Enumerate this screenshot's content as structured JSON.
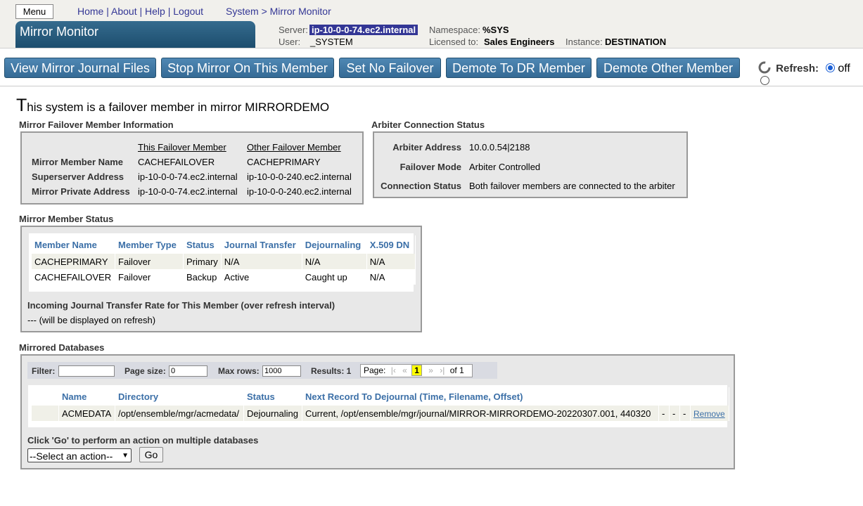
{
  "header": {
    "menu_label": "Menu",
    "links": [
      "Home",
      "About",
      "Help",
      "Logout"
    ],
    "breadcrumb": "System > Mirror Monitor",
    "title": "Mirror Monitor",
    "server_label": "Server:",
    "server": "ip-10-0-0-74.ec2.internal",
    "user_label": "User:",
    "user": "_SYSTEM",
    "namespace_label": "Namespace:",
    "namespace": "%SYS",
    "licensed_label": "Licensed to:",
    "licensed": "Sales Engineers",
    "instance_label": "Instance:",
    "instance": "DESTINATION"
  },
  "toolbar": {
    "buttons": [
      "View Mirror Journal Files",
      "Stop Mirror On This Member",
      "Set No Failover",
      "Demote To DR Member",
      "Demote Other Member"
    ],
    "refresh_label": "Refresh:",
    "refresh_option": "off"
  },
  "page_heading_first": "T",
  "page_heading_rest": "his system is a failover member in mirror MIRRORDEMO",
  "failover_info": {
    "title": "Mirror Failover Member Information",
    "col_this": "This Failover Member",
    "col_other": "Other Failover Member",
    "rows": [
      {
        "label": "Mirror Member Name",
        "this": "CACHEFAILOVER",
        "other": "CACHEPRIMARY"
      },
      {
        "label": "Superserver Address",
        "this": "ip-10-0-0-74.ec2.internal",
        "other": "ip-10-0-0-240.ec2.internal"
      },
      {
        "label": "Mirror Private Address",
        "this": "ip-10-0-0-74.ec2.internal",
        "other": "ip-10-0-0-240.ec2.internal"
      }
    ]
  },
  "arbiter": {
    "title": "Arbiter Connection Status",
    "rows": [
      {
        "label": "Arbiter Address",
        "value": "10.0.0.54|2188"
      },
      {
        "label": "Failover Mode",
        "value": "Arbiter Controlled"
      },
      {
        "label": "Connection Status",
        "value": "Both failover members are connected to the arbiter"
      }
    ]
  },
  "member_status": {
    "title": "Mirror Member Status",
    "columns": [
      "Member Name",
      "Member Type",
      "Status",
      "Journal Transfer",
      "Dejournaling",
      "X.509 DN"
    ],
    "rows": [
      [
        "CACHEPRIMARY",
        "Failover",
        "Primary",
        "N/A",
        "N/A",
        "N/A"
      ],
      [
        "CACHEFAILOVER",
        "Failover",
        "Backup",
        "Active",
        "Caught up",
        "N/A"
      ]
    ],
    "rate_title": "Incoming Journal Transfer Rate for This Member (over refresh interval)",
    "rate_value": "--- (will be displayed on refresh)"
  },
  "databases": {
    "title": "Mirrored Databases",
    "filter_label": "Filter:",
    "filter_value": "",
    "page_size_label": "Page size:",
    "page_size": "0",
    "max_rows_label": "Max rows:",
    "max_rows": "1000",
    "results_label": "Results: 1",
    "page_label": "Page:",
    "page_first": "|‹",
    "page_prev": "«",
    "page_current": "1",
    "page_next": "»",
    "page_last": "›|",
    "page_of": "of 1",
    "columns": [
      "Name",
      "Directory",
      "Status",
      "Next Record To Dejournal (Time, Filename, Offset)"
    ],
    "rows": [
      {
        "name": "ACMEDATA",
        "directory": "/opt/ensemble/mgr/acmedata/",
        "status": "Dejournaling",
        "next": "Current, /opt/ensemble/mgr/journal/MIRROR-MIRRORDEMO-20220307.001, 440320",
        "d1": "-",
        "d2": "-",
        "d3": "-",
        "action": "Remove"
      }
    ],
    "go_hint": "Click 'Go' to perform an action on multiple databases",
    "select_value": "--Select an action--",
    "go_label": "Go"
  },
  "colors": {
    "accent": "#333695",
    "button": "#4a82ae",
    "header_text": "#3b6fa7",
    "highlight": "#ffff00"
  }
}
